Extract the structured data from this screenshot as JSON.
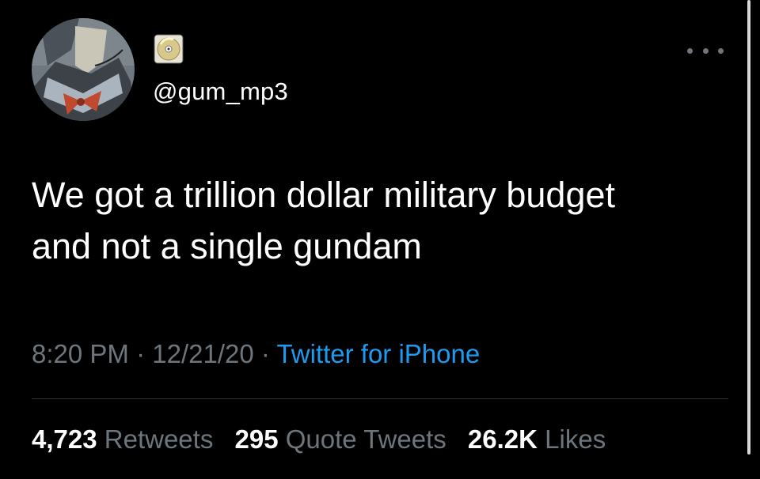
{
  "tweet": {
    "avatar_icon": "profile-avatar",
    "display_name_icon": "cd-disc-emoji",
    "handle": "@gum_mp3",
    "more_icon": "more-icon",
    "text_line1": "We got a trillion dollar military budget",
    "text_line2": "and not a single gundam",
    "time": "8:20 PM",
    "separator": " · ",
    "date": "12/21/20",
    "source": "Twitter for iPhone",
    "retweets_count": "4,723",
    "retweets_label": "Retweets",
    "quote_tweets_count": "295",
    "quote_tweets_label": "Quote Tweets",
    "likes_count": "26.2K",
    "likes_label": "Likes"
  },
  "colors": {
    "background": "#000000",
    "text": "#ffffff",
    "secondary": "#6e767d",
    "link": "#1d9bf0",
    "divider": "#2f3336"
  }
}
